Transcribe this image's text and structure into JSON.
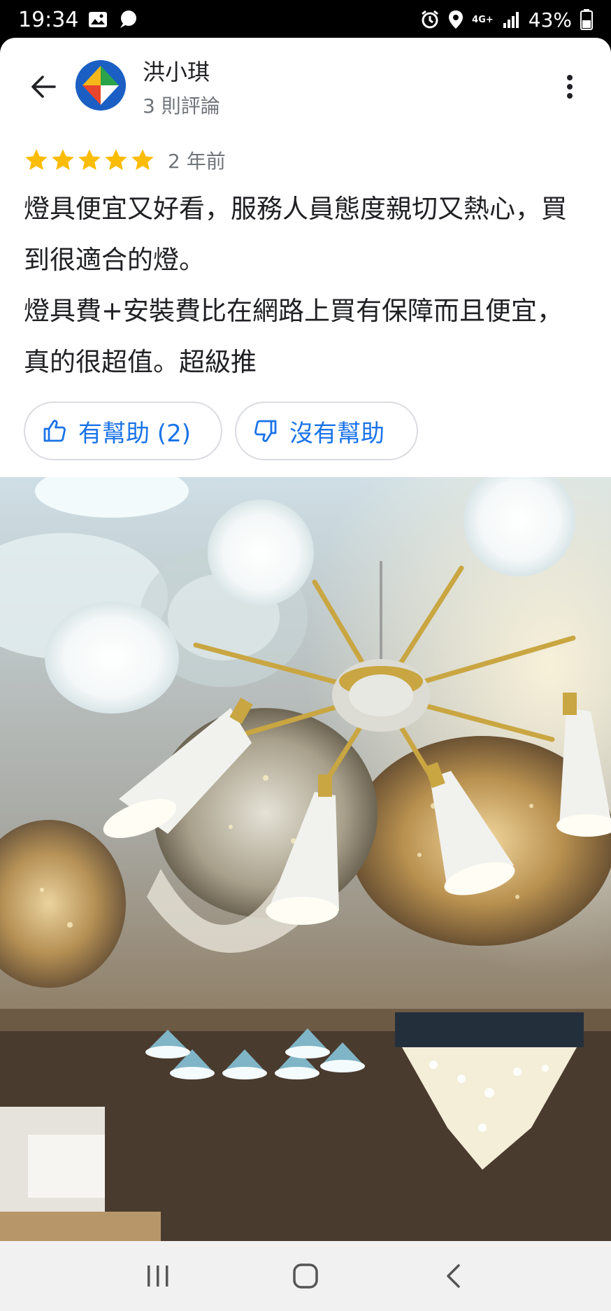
{
  "status_bar": {
    "time": "19:34",
    "network": "4G+",
    "battery": "43%",
    "icons": [
      "image-icon",
      "chat-icon",
      "alarm-icon",
      "location-icon",
      "signal-icon",
      "battery-icon"
    ]
  },
  "header": {
    "reviewer_name": "洪小琪",
    "review_count": "3 則評論",
    "back_icon": "back-arrow-icon",
    "more_icon": "more-vert-icon"
  },
  "review": {
    "rating": 5,
    "max_rating": 5,
    "star_color": "#fbbc04",
    "date": "2 年前",
    "paragraph_1": "燈具便宜又好看，服務人員態度親切又熱心，買到很適合的燈。",
    "paragraph_2": "燈具費+安裝費比在網路上買有保障而且便宜，真的很超值。超級推"
  },
  "feedback": {
    "helpful_label": "有幫助 (2)",
    "not_helpful_label": "沒有幫助",
    "accent_color": "#1a73e8"
  },
  "photo": {
    "subject": "chandelier-photo"
  },
  "nav_bar": {
    "icons": [
      "recent-apps-icon",
      "home-icon",
      "back-icon"
    ]
  }
}
